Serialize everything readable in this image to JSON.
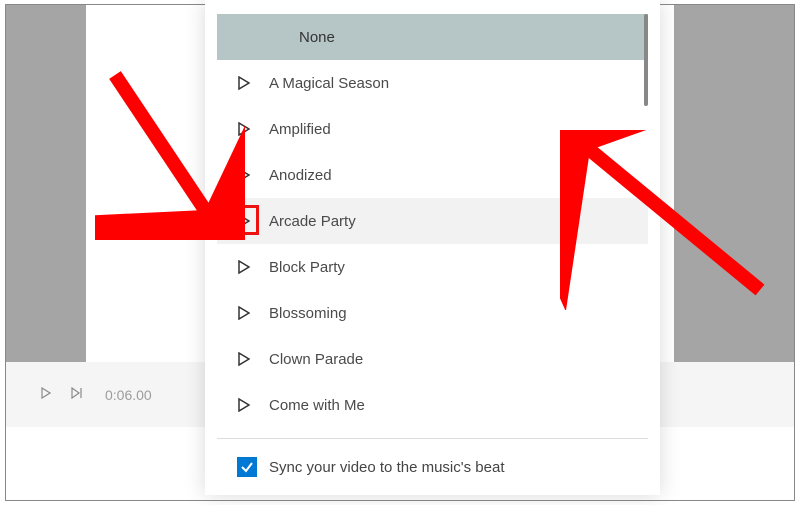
{
  "music_list": {
    "items": [
      {
        "label": "None",
        "selected": true,
        "hovered": false,
        "highlight": false,
        "has_play": false
      },
      {
        "label": "A Magical Season",
        "selected": false,
        "hovered": false,
        "highlight": false,
        "has_play": true
      },
      {
        "label": "Amplified",
        "selected": false,
        "hovered": false,
        "highlight": false,
        "has_play": true
      },
      {
        "label": "Anodized",
        "selected": false,
        "hovered": false,
        "highlight": false,
        "has_play": true
      },
      {
        "label": "Arcade Party",
        "selected": false,
        "hovered": true,
        "highlight": true,
        "has_play": true
      },
      {
        "label": "Block Party",
        "selected": false,
        "hovered": false,
        "highlight": false,
        "has_play": true
      },
      {
        "label": "Blossoming",
        "selected": false,
        "hovered": false,
        "highlight": false,
        "has_play": true
      },
      {
        "label": "Clown Parade",
        "selected": false,
        "hovered": false,
        "highlight": false,
        "has_play": true
      },
      {
        "label": "Come with Me",
        "selected": false,
        "hovered": false,
        "highlight": false,
        "has_play": true
      }
    ]
  },
  "footer": {
    "sync_label": "Sync your video to the music's beat",
    "sync_checked": true
  },
  "timeline": {
    "time": "0:06.00"
  },
  "annotations": {
    "left_arrow": true,
    "right_arrow": true,
    "red_box_on": "Arcade Party"
  }
}
